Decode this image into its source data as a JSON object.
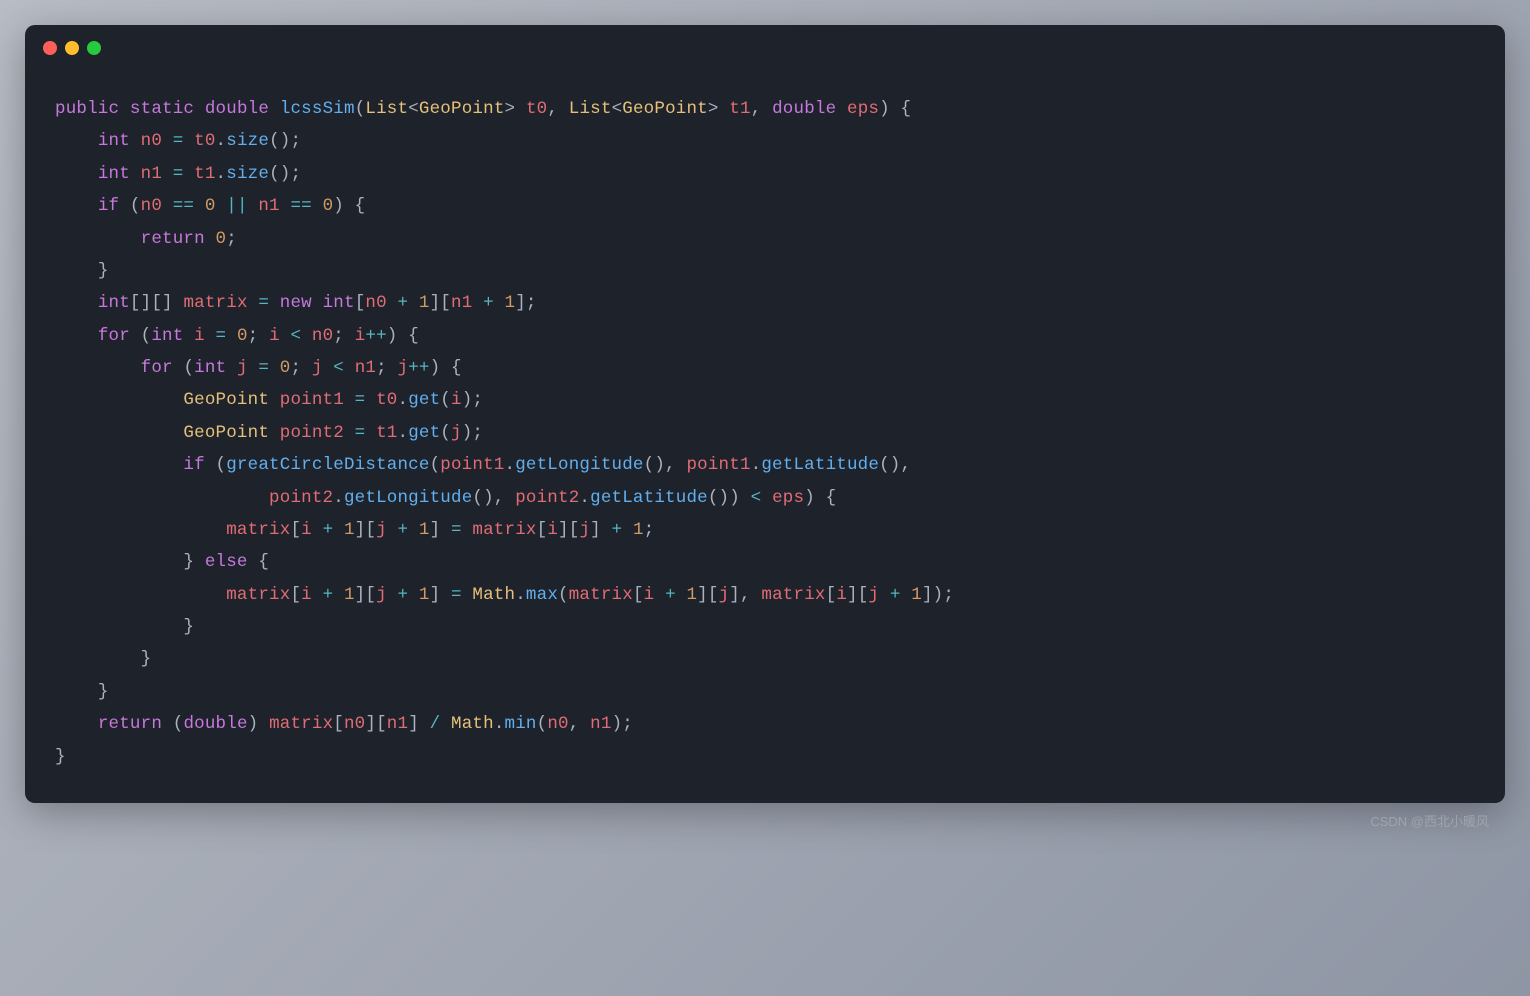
{
  "watermark": "CSDN @西北小暖风",
  "code": {
    "l1": {
      "kw1": "public",
      "kw2": "static",
      "kw3": "double",
      "fn": "lcssSim",
      "cls1": "List",
      "gen1": "GeoPoint",
      "p1": "t0",
      "cls2": "List",
      "gen2": "GeoPoint",
      "p2": "t1",
      "kw4": "double",
      "p3": "eps"
    },
    "l2": {
      "kw": "int",
      "var": "n0",
      "obj": "t0",
      "call": "size"
    },
    "l3": {
      "kw": "int",
      "var": "n1",
      "obj": "t1",
      "call": "size"
    },
    "l4": {
      "kw": "if",
      "v1": "n0",
      "n1": "0",
      "v2": "n1",
      "n2": "0"
    },
    "l5": {
      "kw": "return",
      "n": "0"
    },
    "l7": {
      "kw1": "int",
      "var": "matrix",
      "kw2": "new",
      "kw3": "int",
      "v1": "n0",
      "n1": "1",
      "v2": "n1",
      "n2": "1"
    },
    "l8": {
      "kw": "for",
      "kw2": "int",
      "var": "i",
      "n1": "0",
      "v2": "n0"
    },
    "l9": {
      "kw": "for",
      "kw2": "int",
      "var": "j",
      "n1": "0",
      "v2": "n1"
    },
    "l10": {
      "cls": "GeoPoint",
      "var": "point1",
      "obj": "t0",
      "call": "get",
      "arg": "i"
    },
    "l11": {
      "cls": "GeoPoint",
      "var": "point2",
      "obj": "t1",
      "call": "get",
      "arg": "j"
    },
    "l12": {
      "kw": "if",
      "fn": "greatCircleDistance",
      "o1": "point1",
      "c1": "getLongitude",
      "o2": "point1",
      "c2": "getLatitude"
    },
    "l13": {
      "o1": "point2",
      "c1": "getLongitude",
      "o2": "point2",
      "c2": "getLatitude",
      "var": "eps"
    },
    "l14": {
      "var": "matrix",
      "v1": "i",
      "n1": "1",
      "v2": "j",
      "n2": "1",
      "var2": "matrix",
      "v3": "i",
      "v4": "j",
      "n3": "1"
    },
    "l15": {
      "kw": "else"
    },
    "l16": {
      "var": "matrix",
      "v1": "i",
      "n1": "1",
      "v2": "j",
      "n2": "1",
      "cls": "Math",
      "call": "max",
      "var2": "matrix",
      "v3": "i",
      "n3": "1",
      "v4": "j",
      "var3": "matrix",
      "v5": "i",
      "v6": "j",
      "n4": "1"
    },
    "l20": {
      "kw": "return",
      "kw2": "double",
      "var": "matrix",
      "v1": "n0",
      "v2": "n1",
      "cls": "Math",
      "call": "min",
      "a1": "n0",
      "a2": "n1"
    }
  }
}
